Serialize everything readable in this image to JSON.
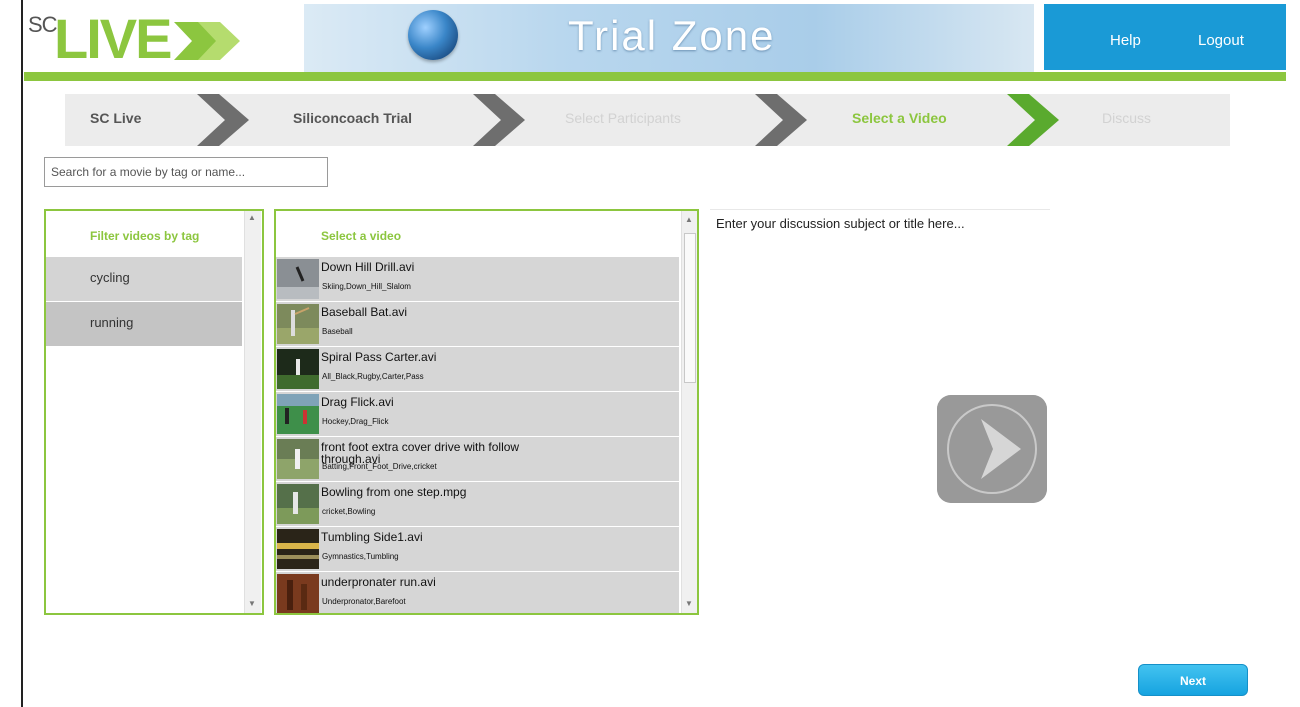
{
  "header": {
    "logo_prefix": "SC",
    "logo_word": "LIVE",
    "banner_title": "Trial Zone",
    "help": "Help",
    "logout": "Logout"
  },
  "breadcrumb": [
    {
      "label": "SC Live",
      "state": "done"
    },
    {
      "label": "Siliconcoach Trial",
      "state": "done"
    },
    {
      "label": "Select Participants",
      "state": "pending"
    },
    {
      "label": "Select a Video",
      "state": "current"
    },
    {
      "label": "Discuss",
      "state": "pending"
    }
  ],
  "search": {
    "placeholder": "Search for a movie by tag or name..."
  },
  "tags": {
    "header": "Filter videos by tag",
    "items": [
      "cycling",
      "running"
    ]
  },
  "videos": {
    "header": "Select a video",
    "items": [
      {
        "title": "Down Hill Drill.avi",
        "tags": "Skiing,Down_Hill_Slalom"
      },
      {
        "title": "Baseball Bat.avi",
        "tags": "Baseball"
      },
      {
        "title": "Spiral Pass Carter.avi",
        "tags": "All_Black,Rugby,Carter,Pass"
      },
      {
        "title": "Drag Flick.avi",
        "tags": "Hockey,Drag_Flick"
      },
      {
        "title": "front foot extra cover drive with follow through.avi",
        "tags": "Batting,Front_Foot_Drive,cricket"
      },
      {
        "title": "Bowling from one step.mpg",
        "tags": "cricket,Bowling"
      },
      {
        "title": "Tumbling Side1.avi",
        "tags": "Gymnastics,Tumbling"
      },
      {
        "title": "underpronater run.avi",
        "tags": "Underpronator,Barefoot"
      }
    ]
  },
  "discussion": {
    "placeholder": "Enter your discussion subject or title here..."
  },
  "actions": {
    "next": "Next"
  },
  "colors": {
    "accent_green": "#8cc63f",
    "accent_blue": "#1a9ad6",
    "muted_text": "#cfcfcf"
  }
}
